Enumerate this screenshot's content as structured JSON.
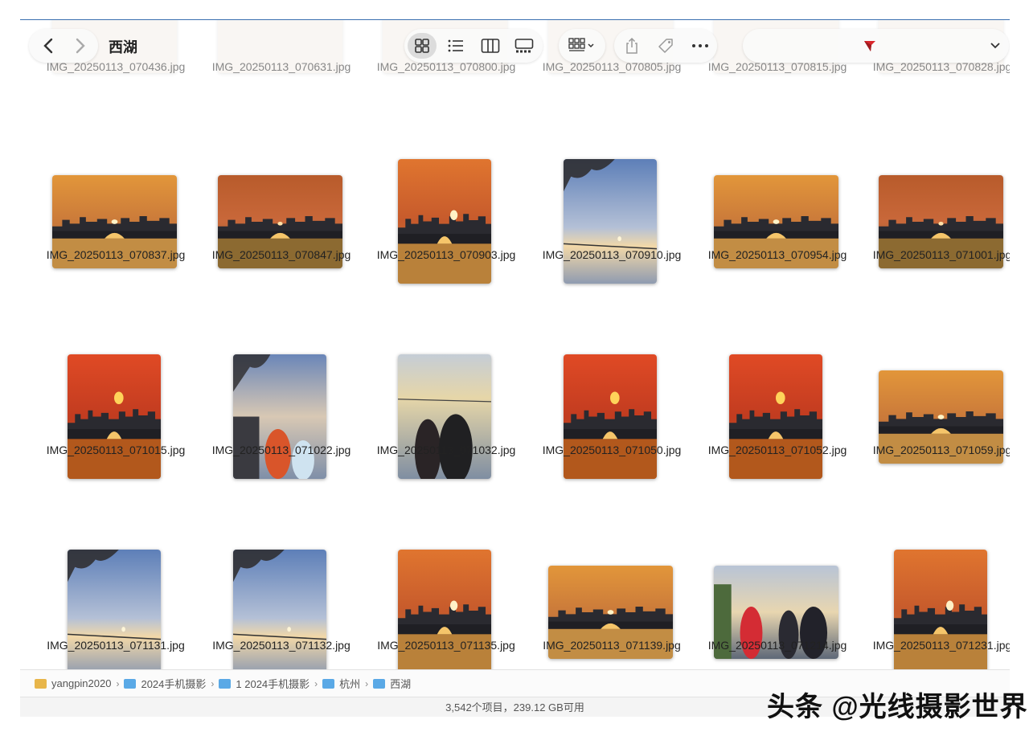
{
  "window": {
    "title": "西湖",
    "accent": "#3a6fb0"
  },
  "toolbar": {
    "back_icon": "chevron-left-icon",
    "forward_icon": "chevron-right-icon",
    "views": [
      "icon-view-icon",
      "list-view-icon",
      "column-view-icon",
      "gallery-view-icon"
    ],
    "active_view": "icon-view-icon",
    "group_icon": "group-grid-icon",
    "share_icon": "share-icon",
    "tag_icon": "tag-icon",
    "more_icon": "more-icon",
    "search_icon": "red-flag-icon",
    "search_value": ""
  },
  "files": [
    {
      "name": "IMG_20250113_070436.jpg",
      "kind": "wide",
      "scene": "top"
    },
    {
      "name": "IMG_20250113_070631.jpg",
      "kind": "wide",
      "scene": "top"
    },
    {
      "name": "IMG_20250113_070800.jpg",
      "kind": "wide",
      "scene": "top"
    },
    {
      "name": "IMG_20250113_070805.jpg",
      "kind": "wide",
      "scene": "top"
    },
    {
      "name": "IMG_20250113_070815.jpg",
      "kind": "wide",
      "scene": "top"
    },
    {
      "name": "IMG_20250113_070828.jpg",
      "kind": "wide",
      "scene": "top"
    },
    {
      "name": "IMG_20250113_070837.jpg",
      "kind": "wide",
      "scene": "sunset-amber"
    },
    {
      "name": "IMG_20250113_070847.jpg",
      "kind": "wide",
      "scene": "sunset-dark"
    },
    {
      "name": "IMG_20250113_070903.jpg",
      "kind": "tall",
      "scene": "sunset-orange"
    },
    {
      "name": "IMG_20250113_070910.jpg",
      "kind": "tall",
      "scene": "blue-tree"
    },
    {
      "name": "IMG_20250113_070954.jpg",
      "kind": "wide",
      "scene": "sunset-amber"
    },
    {
      "name": "IMG_20250113_071001.jpg",
      "kind": "wide",
      "scene": "sunset-dark"
    },
    {
      "name": "IMG_20250113_071015.jpg",
      "kind": "tall",
      "scene": "sunset-red"
    },
    {
      "name": "IMG_20250113_071022.jpg",
      "kind": "tall",
      "scene": "people-tree"
    },
    {
      "name": "IMG_20250113_071032.jpg",
      "kind": "tall",
      "scene": "couple"
    },
    {
      "name": "IMG_20250113_071050.jpg",
      "kind": "tall",
      "scene": "sunset-red"
    },
    {
      "name": "IMG_20250113_071052.jpg",
      "kind": "tall",
      "scene": "sunset-red"
    },
    {
      "name": "IMG_20250113_071059.jpg",
      "kind": "wide",
      "scene": "sunset-amber"
    },
    {
      "name": "IMG_20250113_071131.jpg",
      "kind": "tall",
      "scene": "blue-tree"
    },
    {
      "name": "IMG_20250113_071132.jpg",
      "kind": "tall",
      "scene": "blue-tree"
    },
    {
      "name": "IMG_20250113_071135.jpg",
      "kind": "tall",
      "scene": "sunset-orange"
    },
    {
      "name": "IMG_20250113_071139.jpg",
      "kind": "wide",
      "scene": "sunset-amber"
    },
    {
      "name": "IMG_20250113_071214.jpg",
      "kind": "wide",
      "scene": "crowd"
    },
    {
      "name": "IMG_20250113_071231.jpg",
      "kind": "tall",
      "scene": "sunset-orange"
    }
  ],
  "path": [
    {
      "label": "yangpin2020",
      "icon": "home-folder-icon",
      "color": "#e8b64a"
    },
    {
      "label": "2024手机摄影",
      "icon": "folder-icon",
      "color": "#5aa9e6"
    },
    {
      "label": "1 2024手机摄影",
      "icon": "folder-icon",
      "color": "#5aa9e6"
    },
    {
      "label": "杭州",
      "icon": "folder-icon",
      "color": "#5aa9e6"
    },
    {
      "label": "西湖",
      "icon": "folder-icon",
      "color": "#5aa9e6"
    }
  ],
  "status": "3,542个项目，239.12 GB可用",
  "watermark": "头条 @光线摄影世界"
}
